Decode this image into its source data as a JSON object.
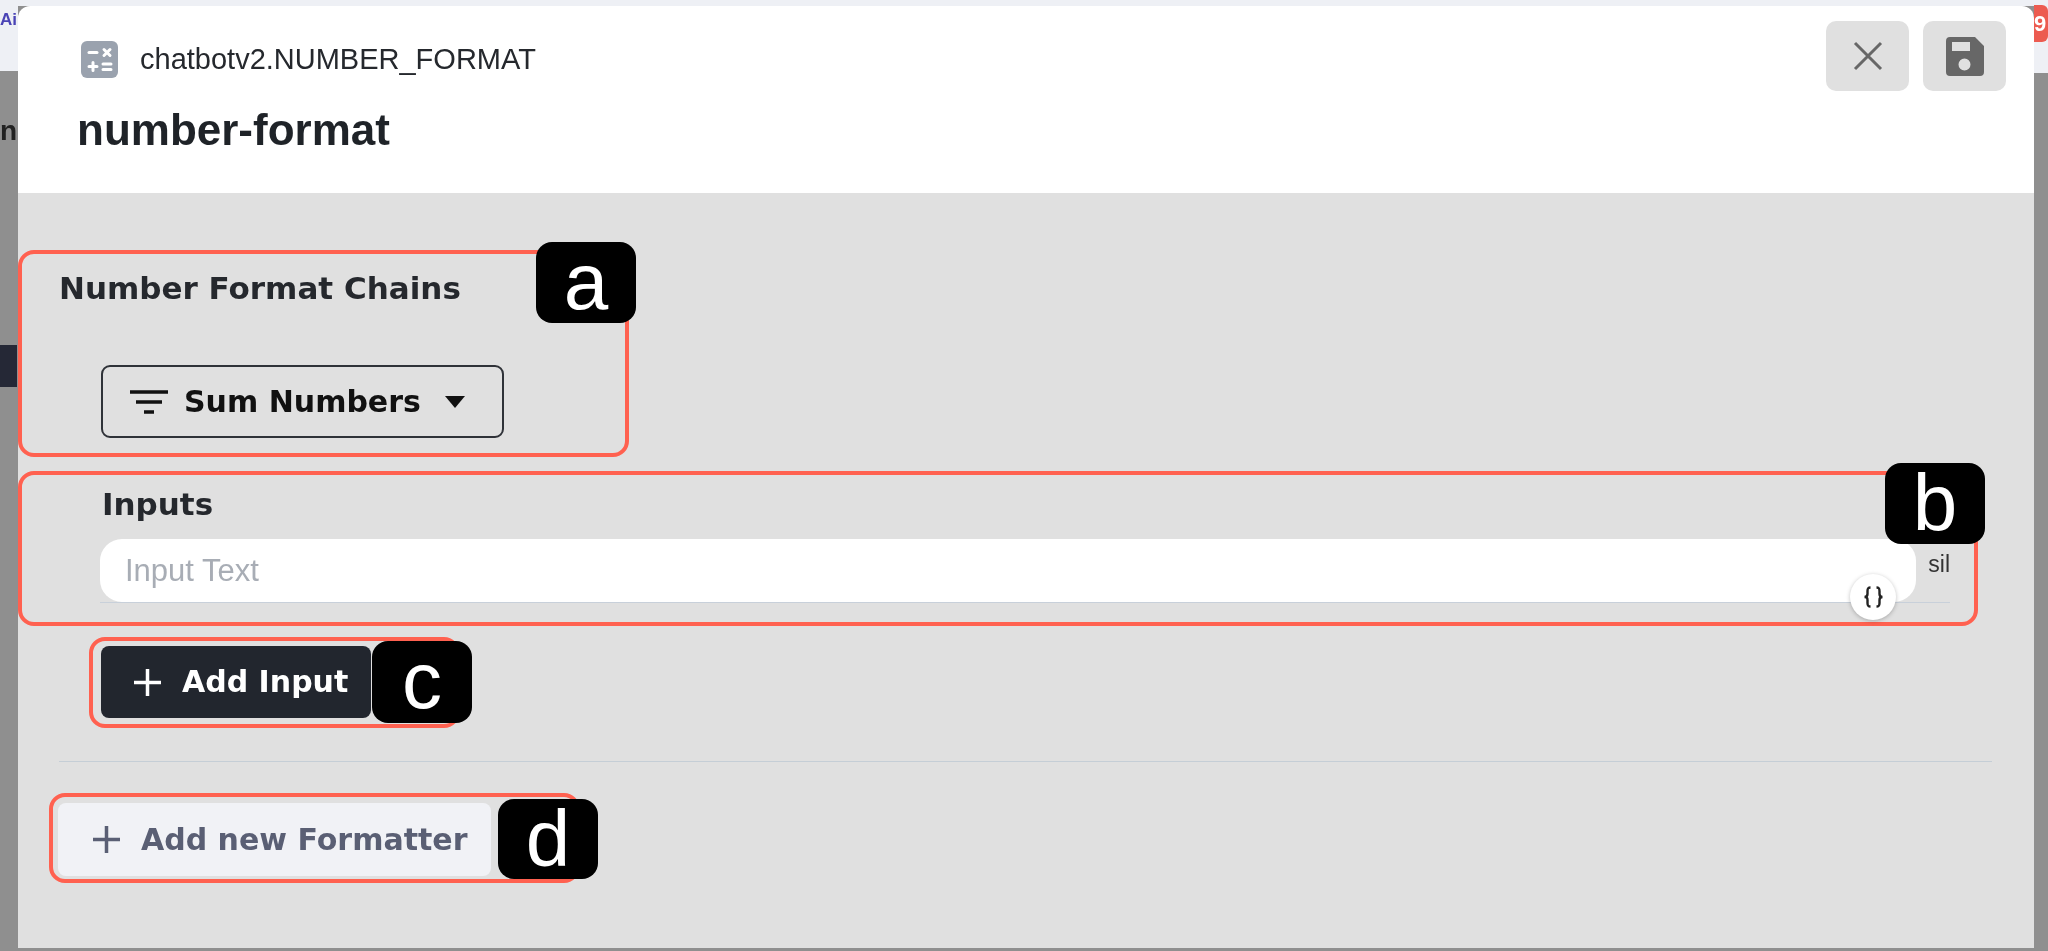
{
  "backdrop": {
    "texts": [
      {
        "kind": "brand",
        "text": "Ai"
      },
      {
        "kind": "heading",
        "text": "n"
      }
    ],
    "badge": "9"
  },
  "dialog": {
    "source": "chatbotv2.NUMBER_FORMAT",
    "title": "number-format",
    "actions": [
      {
        "kind": "close"
      },
      {
        "kind": "save"
      }
    ]
  },
  "chains": {
    "callout": "a",
    "heading": "Number Format Chains",
    "dropdown": {
      "value": "Sum Numbers"
    }
  },
  "inputs": {
    "callout": "b",
    "heading": "Inputs",
    "fields": [
      {
        "placeholder": "Input Text",
        "delete_label": "sil"
      }
    ]
  },
  "add_input": {
    "callout": "c",
    "label": "Add Input"
  },
  "add_formatter": {
    "callout": "d",
    "label": "Add new Formatter"
  }
}
